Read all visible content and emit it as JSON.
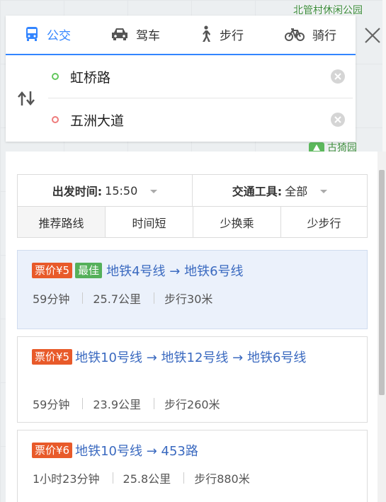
{
  "map": {
    "labels": [
      "北管村休闲公园",
      "古猗园"
    ]
  },
  "modes": [
    {
      "label": "公交",
      "icon": "bus-icon",
      "active": true
    },
    {
      "label": "驾车",
      "icon": "car-icon",
      "active": false
    },
    {
      "label": "步行",
      "icon": "walk-icon",
      "active": false
    },
    {
      "label": "骑行",
      "icon": "bike-icon",
      "active": false
    }
  ],
  "route": {
    "start": "虹桥路",
    "end": "五洲大道"
  },
  "filters": {
    "depart_label": "出发时间:",
    "depart_value": "15:50",
    "transport_label": "交通工具:",
    "transport_value": "全部"
  },
  "sort_tabs": [
    "推荐路线",
    "时间短",
    "少换乘",
    "少步行"
  ],
  "results": [
    {
      "price": "票价¥5",
      "best": "最佳",
      "lines": "地铁4号线 → 地铁6号线",
      "duration": "59分钟",
      "distance": "25.7公里",
      "walk": "步行30米"
    },
    {
      "price": "票价¥5",
      "best": "",
      "lines": "地铁10号线 → 地铁12号线 → 地铁6号线",
      "duration": "59分钟",
      "distance": "23.9公里",
      "walk": "步行260米"
    },
    {
      "price": "票价¥6",
      "best": "",
      "lines": "地铁10号线 → 453路",
      "duration": "1小时23分钟",
      "distance": "25.8公里",
      "walk": "步行880米"
    }
  ],
  "colors": {
    "accent": "#3385ff",
    "price": "#e85a2a",
    "best": "#55b05a",
    "link": "#3b6ac0"
  }
}
